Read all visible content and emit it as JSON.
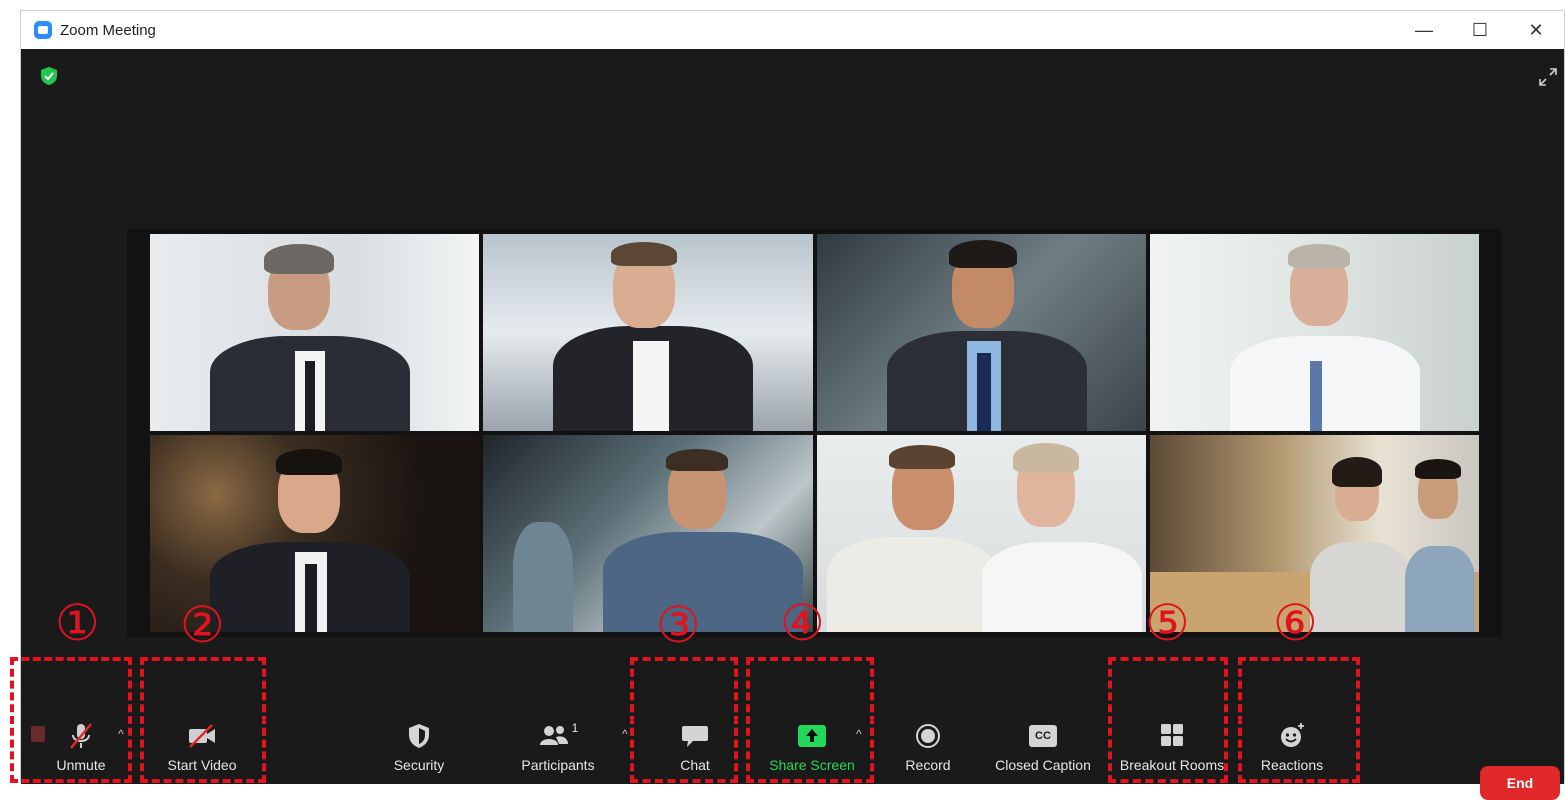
{
  "window": {
    "title": "Zoom Meeting",
    "minimize_glyph": "—",
    "maximize_glyph": "☐",
    "close_glyph": "✕"
  },
  "security_shield_icon": "shield-check-icon",
  "participants_count": "1",
  "toolbar": {
    "unmute": "Unmute",
    "start_video": "Start Video",
    "security": "Security",
    "participants": "Participants",
    "chat": "Chat",
    "share_screen": "Share Screen",
    "record": "Record",
    "closed_caption": "Closed Caption",
    "breakout_rooms": "Breakout Rooms",
    "reactions": "Reactions",
    "end": "End",
    "cc_glyph": "CC"
  },
  "annotations": [
    "①",
    "②",
    "③",
    "④",
    "⑤",
    "⑥"
  ],
  "colors": {
    "accent_green": "#23d959",
    "end_red": "#e02828",
    "annotation_red": "#e0141e",
    "zoom_blue": "#2d8cff"
  }
}
